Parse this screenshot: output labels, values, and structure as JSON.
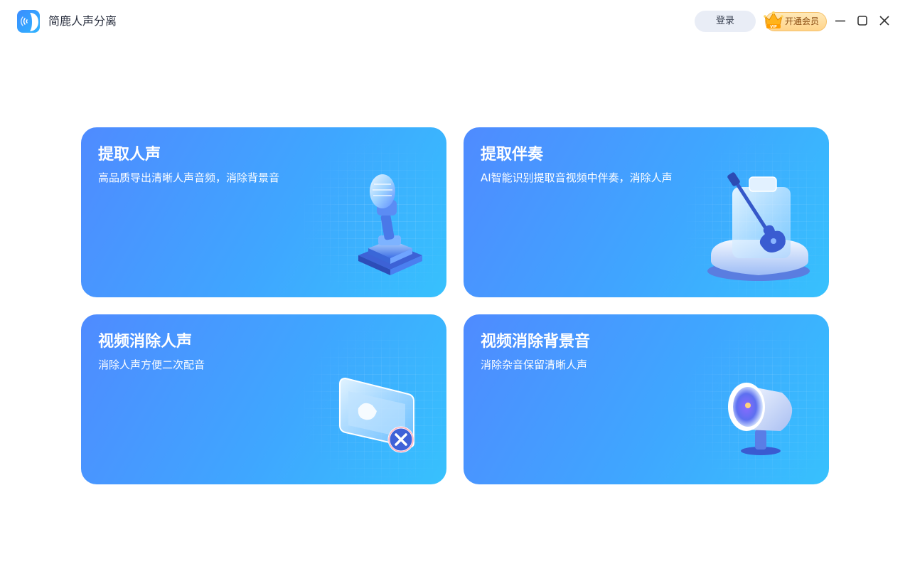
{
  "app": {
    "title": "简鹿人声分离",
    "logo_icon": "app-logo-icon"
  },
  "header": {
    "login_label": "登录",
    "vip_label": "开通会员",
    "vip_badge": "VIP",
    "window_controls": [
      "minimize-icon",
      "maximize-icon",
      "close-icon"
    ]
  },
  "colors": {
    "card_gradient_start": "#4f8bff",
    "card_gradient_end": "#37c1fd",
    "login_bg": "#e9edf6",
    "vip_bg": "#ffd48a"
  },
  "cards": [
    {
      "title": "提取人声",
      "desc": "高品质导出清晰人声音频，消除背景音",
      "icon": "microphone-icon"
    },
    {
      "title": "提取伴奏",
      "desc": "AI智能识别提取音视频中伴奏，消除人声",
      "icon": "guitar-icon"
    },
    {
      "title": "视频消除人声",
      "desc": "消除人声方便二次配音",
      "icon": "video-remove-icon"
    },
    {
      "title": "视频消除背景音",
      "desc": "消除杂音保留清晰人声",
      "icon": "speaker-icon"
    }
  ]
}
